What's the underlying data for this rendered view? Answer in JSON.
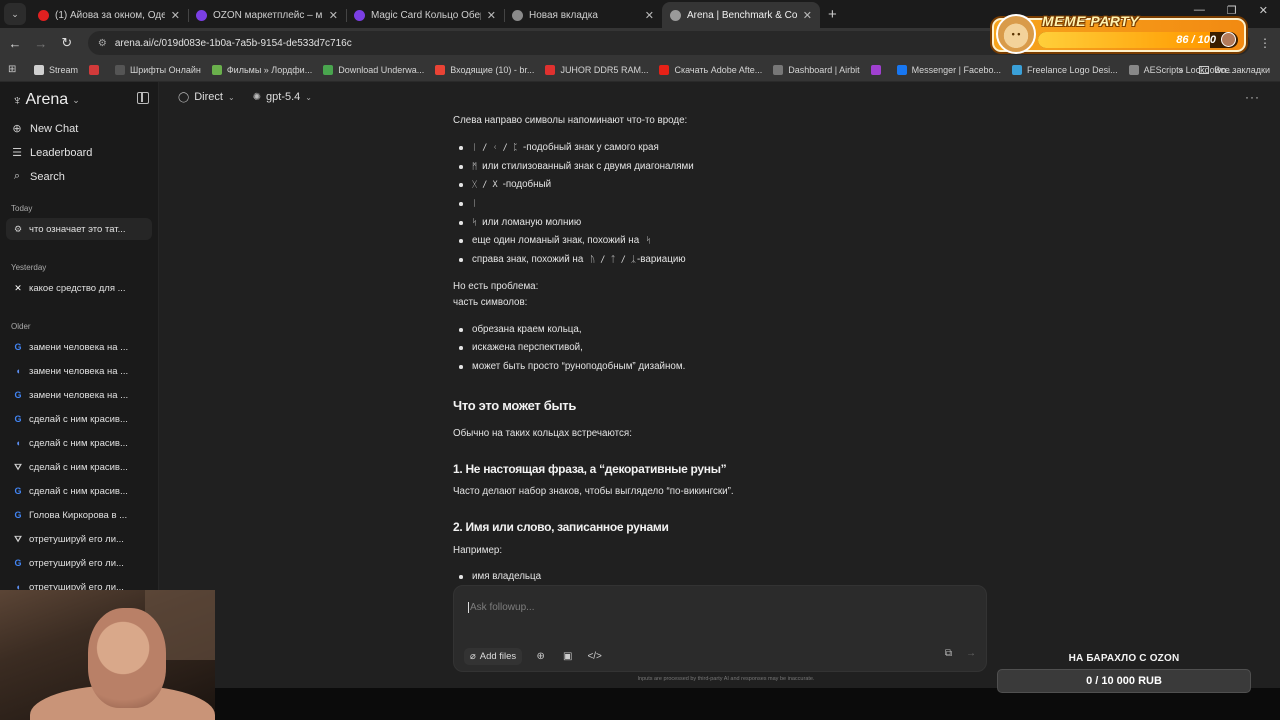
{
  "tabs": [
    {
      "title": "(1) Айова за окном, Одесса в г",
      "fav_color": "#e02020",
      "active": false
    },
    {
      "title": "OZON маркетплейс – миллион",
      "fav_color": "#7b3fe4",
      "active": false
    },
    {
      "title": "Magic Card Кольцо Оберег ку",
      "fav_color": "#7b3fe4",
      "active": false
    },
    {
      "title": "Новая вкладка",
      "fav_color": "#8a8a8a",
      "active": false
    },
    {
      "title": "Arena | Benchmark & Compare",
      "fav_color": "#9a9a9a",
      "active": true
    }
  ],
  "address": {
    "url": "arena.ai/c/019d083e-1b0a-7a5b-9154-de533d7c716c"
  },
  "bookmarks": [
    {
      "label": "Stream",
      "color": "#cfcfcf"
    },
    {
      "label": "",
      "color": "#d23a3a"
    },
    {
      "label": "Шрифты Онлайн",
      "color": "#555"
    },
    {
      "label": "Фильмы » Лордфи...",
      "color": "#6ab04c"
    },
    {
      "label": "Download Underwa...",
      "color": "#49a54e"
    },
    {
      "label": "Входящие (10) - br...",
      "color": "#ea4335"
    },
    {
      "label": "JUHOR DDR5 RAM...",
      "color": "#e0312f"
    },
    {
      "label": "Скачать Adobe Afte...",
      "color": "#e62117"
    },
    {
      "label": "Dashboard | Airbit",
      "color": "#777"
    },
    {
      "label": "",
      "color": "#a040d0"
    },
    {
      "label": "Messenger | Facebo...",
      "color": "#1877f2"
    },
    {
      "label": "Freelance Logo Desi...",
      "color": "#3aa0d8"
    },
    {
      "label": "AEScripts Lockdown...",
      "color": "#888"
    }
  ],
  "bookmarks_all": "Все закладки",
  "meme_party": {
    "title": "MEME PARTY",
    "count": "86 / 100",
    "progress": 0.86
  },
  "sidebar": {
    "brand": "Arena",
    "nav": [
      {
        "label": "New Chat",
        "icon": "plus-circle-icon"
      },
      {
        "label": "Leaderboard",
        "icon": "list-icon"
      },
      {
        "label": "Search",
        "icon": "search-icon"
      }
    ],
    "sections": {
      "today": "Today",
      "yesterday": "Yesterday",
      "older": "Older"
    },
    "today_items": [
      {
        "label": "что означает это тат...",
        "icon": "settings-icon",
        "color": "#cfcfcf"
      }
    ],
    "yesterday_items": [
      {
        "label": "какое средство для ...",
        "icon": "x-logo-icon",
        "color": "#ffffff"
      }
    ],
    "older_items": [
      {
        "label": "замени человека на ...",
        "icon": "google-icon",
        "color": "#4285f4"
      },
      {
        "label": "замени человека на ...",
        "icon": "model-icon",
        "color": "#5b8def"
      },
      {
        "label": "замени человека на ...",
        "icon": "google-icon",
        "color": "#4285f4"
      },
      {
        "label": "сделай с ним красив...",
        "icon": "google-icon",
        "color": "#4285f4"
      },
      {
        "label": "сделай с ним красив...",
        "icon": "model-icon",
        "color": "#5b8def"
      },
      {
        "label": "сделай с ним красив...",
        "icon": "triangle-icon",
        "color": "#d0d0d0"
      },
      {
        "label": "сделай с ним красив...",
        "icon": "google-icon",
        "color": "#4285f4"
      },
      {
        "label": "Голова Киркорова в ...",
        "icon": "google-icon",
        "color": "#4285f4"
      },
      {
        "label": "отретушируй его ли...",
        "icon": "triangle-icon",
        "color": "#d0d0d0"
      },
      {
        "label": "отретушируй его ли...",
        "icon": "google-icon",
        "color": "#4285f4"
      },
      {
        "label": "отретушируй его ли...",
        "icon": "model-icon",
        "color": "#5b8def"
      }
    ]
  },
  "topbar": {
    "mode": "Direct",
    "model": "gpt-5.4"
  },
  "message": {
    "intro": "Слева направо символы напоминают что-то вроде:",
    "symbols": [
      {
        "code": "ᛁ / ᚲ / ᛈ",
        "text": "-подобный знак у самого края"
      },
      {
        "code": "ᛗ",
        "text": "или стилизованный знак с двумя диагоналями"
      },
      {
        "code": "ᚷ / X",
        "text": "-подобный"
      },
      {
        "code": "ᛁ",
        "text": ""
      },
      {
        "code": "ᛋ",
        "text": "или ломаную молнию"
      },
      {
        "code": "",
        "text": "еще один ломаный знак, похожий на",
        "code_after": "ᛋ"
      },
      {
        "code": "",
        "text": "справа знак, похожий на",
        "code_after": "ᚢ / ᛏ / ᛣ",
        "text_after": "-вариацию"
      }
    ],
    "problem_1": "Но есть проблема:",
    "problem_2": "часть символов:",
    "problems": [
      "обрезана краем кольца,",
      "искажена перспективой,",
      "может быть просто “руноподобным” дизайном."
    ],
    "heading": "Что это может быть",
    "usual": "Обычно на таких кольцах встречаются:",
    "h1": "1. Не настоящая фраза, а “декоративные руны”",
    "h1_text": "Часто делают набор знаков, чтобы выглядело “по-викингски”.",
    "h2": "2. Имя или слово, записанное рунами",
    "example": "Например:",
    "example_items": [
      "имя владельца"
    ]
  },
  "composer": {
    "placeholder": "Ask followup...",
    "add_files": "Add files",
    "disclaimer": "Inputs are processed by third-party AI and responses may be inaccurate."
  },
  "ozon": {
    "title": "НА БАРАХЛО С OZON",
    "amount": "0 / 10 000 RUB",
    "progress": 0
  }
}
